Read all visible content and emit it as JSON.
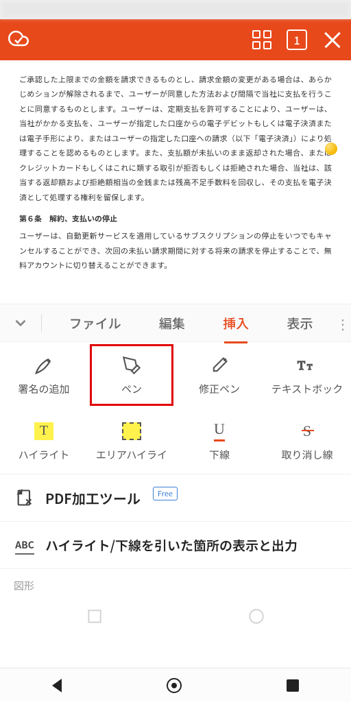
{
  "header": {
    "page_num": "1"
  },
  "document": {
    "p1": "ご承認した上限までの金額を請求できるものとし、請求金額の変更がある場合は、あらかじめションが解除されるまで、ユーザーが同意した方法および間隔で当社に支払を行うことに同意するものとします。ユーザーは、定期支払を許可することにより、ユーザーは、当社がかかる支払を、ユーザーが指定した口座からの電子デビットもしくは電子決済または電子手形により、またはユーザーの指定した口座への請求（以下「電子決済」）により処理することを認めるものとします。また、支払額が未払いのまま返却された場合、またはクレジットカードもしくはこれに類する取引が拒否もしくは拒絶された場合、当社は、該当する返却額および拒絶額相当の金銭または残高不足手数料を回収し、その支払を電子決済として処理する権利を留保します。",
    "h1": "第６条　解約、支払いの停止",
    "p2": "ユーザーは、自動更新サービスを適用しているサブスクリプションの停止をいつでもキャンセルすることができ、次回の未払い請求期間に対する将来の請求を停止することで、無料アカウントに切り替えることができます。"
  },
  "tabs": {
    "file": "ファイル",
    "edit": "編集",
    "insert": "挿入",
    "view": "表示"
  },
  "tools": {
    "signature": "署名の追加",
    "pen": "ペン",
    "correction": "修正ペン",
    "textbox": "テキストボック",
    "highlight": "ハイライト",
    "area_highlight": "エリアハイライ",
    "underline": "下線",
    "strikethrough": "取り消し線"
  },
  "sections": {
    "pdf_tools": "PDF加工ツール",
    "free_badge": "Free",
    "highlight_output": "ハイライト/下線を引いた箇所の表示と出力",
    "shapes": "図形"
  }
}
